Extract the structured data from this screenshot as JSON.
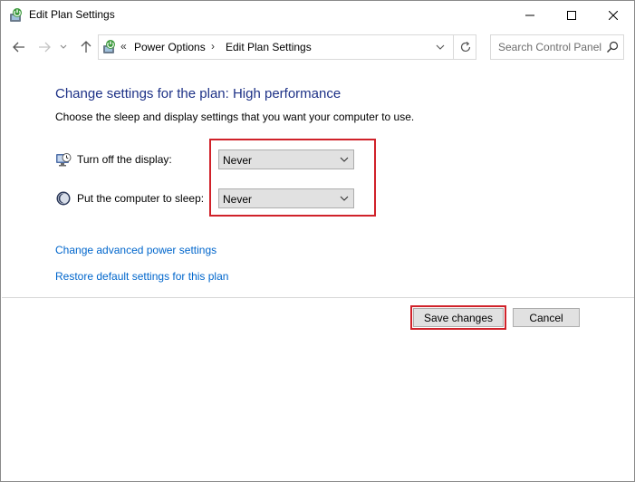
{
  "window": {
    "title": "Edit Plan Settings",
    "icon": "power-options-icon"
  },
  "address_bar": {
    "prefix": "«",
    "crumbs": [
      "Power Options",
      "Edit Plan Settings"
    ],
    "separator": "›"
  },
  "search": {
    "placeholder": "Search Control Panel"
  },
  "main": {
    "heading": "Change settings for the plan: High performance",
    "subtitle": "Choose the sleep and display settings that you want your computer to use.",
    "settings": [
      {
        "label": "Turn off the display:",
        "value": "Never",
        "icon": "monitor-clock-icon"
      },
      {
        "label": "Put the computer to sleep:",
        "value": "Never",
        "icon": "moon-icon"
      }
    ],
    "links": {
      "advanced": "Change advanced power settings",
      "restore": "Restore default settings for this plan"
    }
  },
  "buttons": {
    "save": "Save changes",
    "cancel": "Cancel"
  },
  "colors": {
    "heading": "#1e3287",
    "link": "#0066cc",
    "highlight": "#d0222a"
  }
}
